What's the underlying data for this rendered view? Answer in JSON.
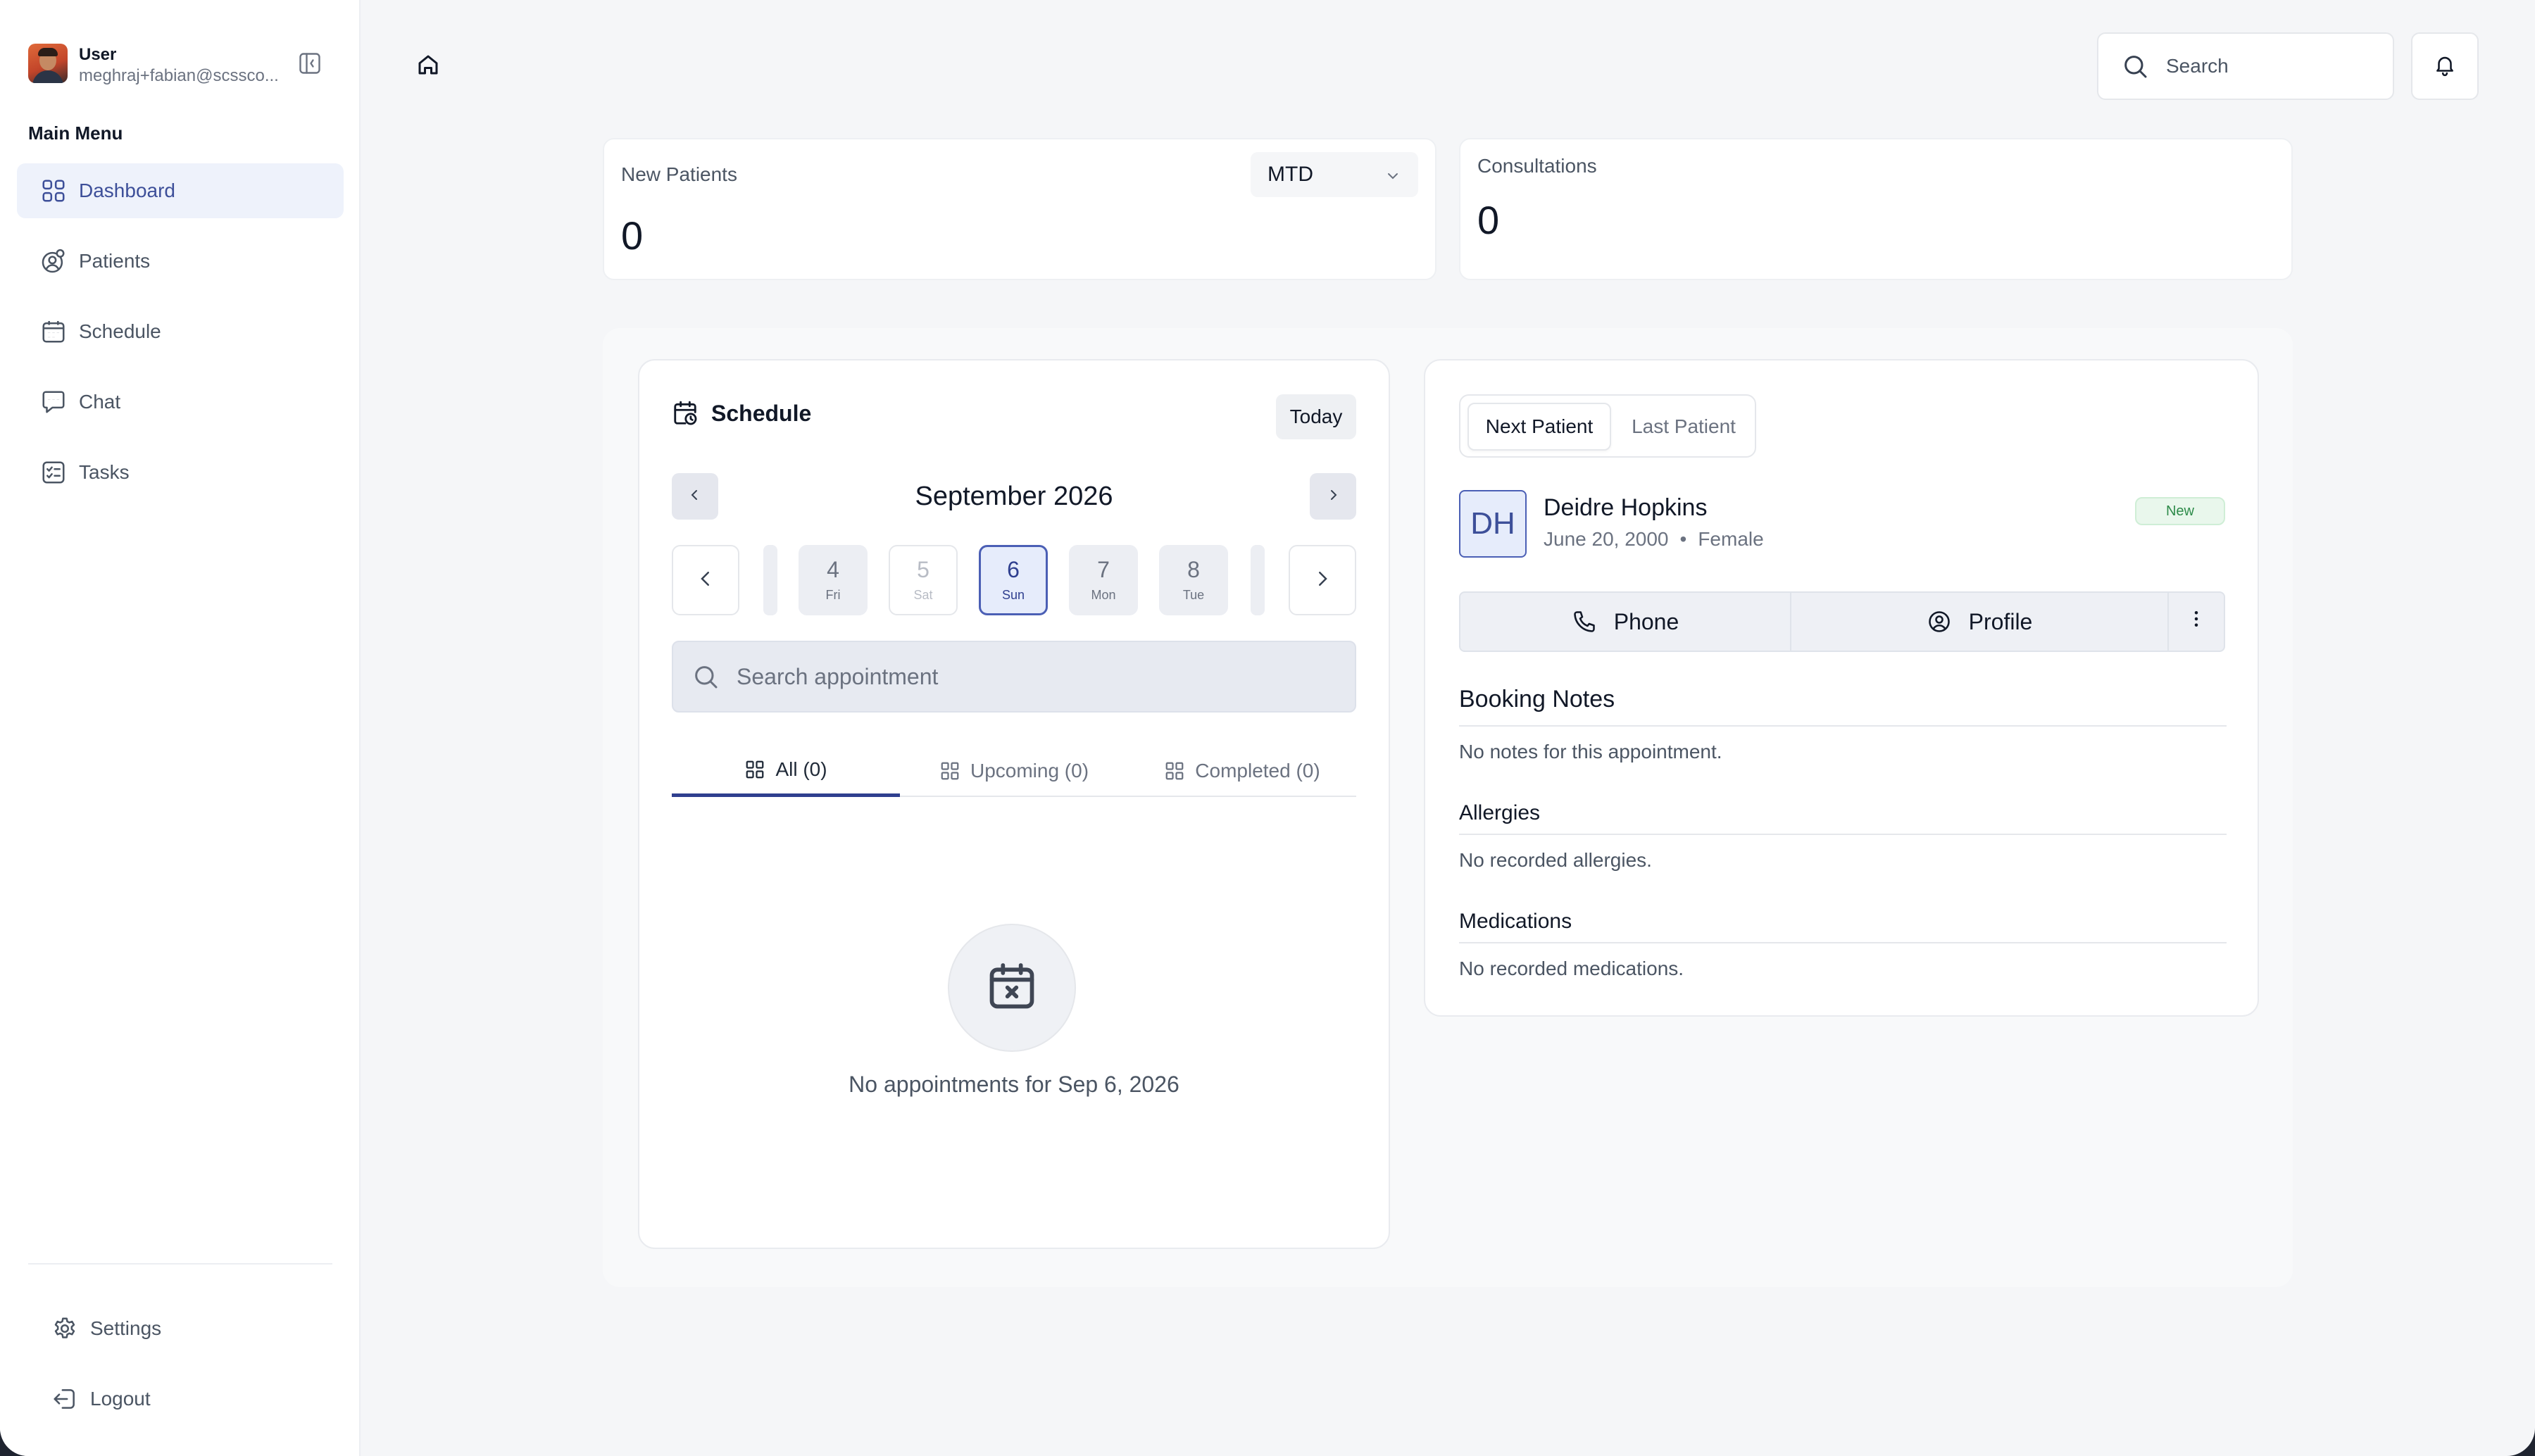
{
  "user": {
    "name": "User",
    "email": "meghraj+fabian@scssco..."
  },
  "sidebar": {
    "main_menu_label": "Main Menu",
    "items": [
      {
        "label": "Dashboard",
        "icon": "dashboard-icon",
        "active": true
      },
      {
        "label": "Patients",
        "icon": "patients-icon"
      },
      {
        "label": "Schedule",
        "icon": "calendar-icon"
      },
      {
        "label": "Chat",
        "icon": "chat-icon"
      },
      {
        "label": "Tasks",
        "icon": "tasks-icon"
      }
    ],
    "bottom": [
      {
        "label": "Settings",
        "icon": "gear-icon"
      },
      {
        "label": "Logout",
        "icon": "logout-icon"
      }
    ]
  },
  "header": {
    "search_placeholder": "Search"
  },
  "stats": {
    "new_patients": {
      "label": "New Patients",
      "value": "0",
      "period": "MTD"
    },
    "consultations": {
      "label": "Consultations",
      "value": "0"
    }
  },
  "schedule": {
    "title": "Schedule",
    "today_label": "Today",
    "month": "September 2026",
    "days": [
      {
        "num": "4",
        "name": "Fri"
      },
      {
        "num": "5",
        "name": "Sat"
      },
      {
        "num": "6",
        "name": "Sun"
      },
      {
        "num": "7",
        "name": "Mon"
      },
      {
        "num": "8",
        "name": "Tue"
      }
    ],
    "selected_day": "6",
    "search_placeholder": "Search appointment",
    "tabs": [
      "All (0)",
      "Upcoming (0)",
      "Completed (0)"
    ],
    "active_tab": "All (0)",
    "empty_message": "No appointments for Sep 6, 2026"
  },
  "patient": {
    "tabs": [
      "Next Patient",
      "Last Patient"
    ],
    "active_tab": "Next Patient",
    "initials": "DH",
    "name": "Deidre Hopkins",
    "dob": "June 20, 2000",
    "gender": "Female",
    "badge": "New",
    "actions": {
      "phone": "Phone",
      "profile": "Profile"
    },
    "booking_notes": {
      "title": "Booking Notes",
      "text": "No notes for this appointment."
    },
    "allergies": {
      "title": "Allergies",
      "text": "No recorded allergies."
    },
    "medications": {
      "title": "Medications",
      "text": "No recorded medications."
    }
  },
  "colors": {
    "accent": "#3d4f99",
    "accent_light": "#eef2fb",
    "badge_green": "#2e8b4a"
  }
}
